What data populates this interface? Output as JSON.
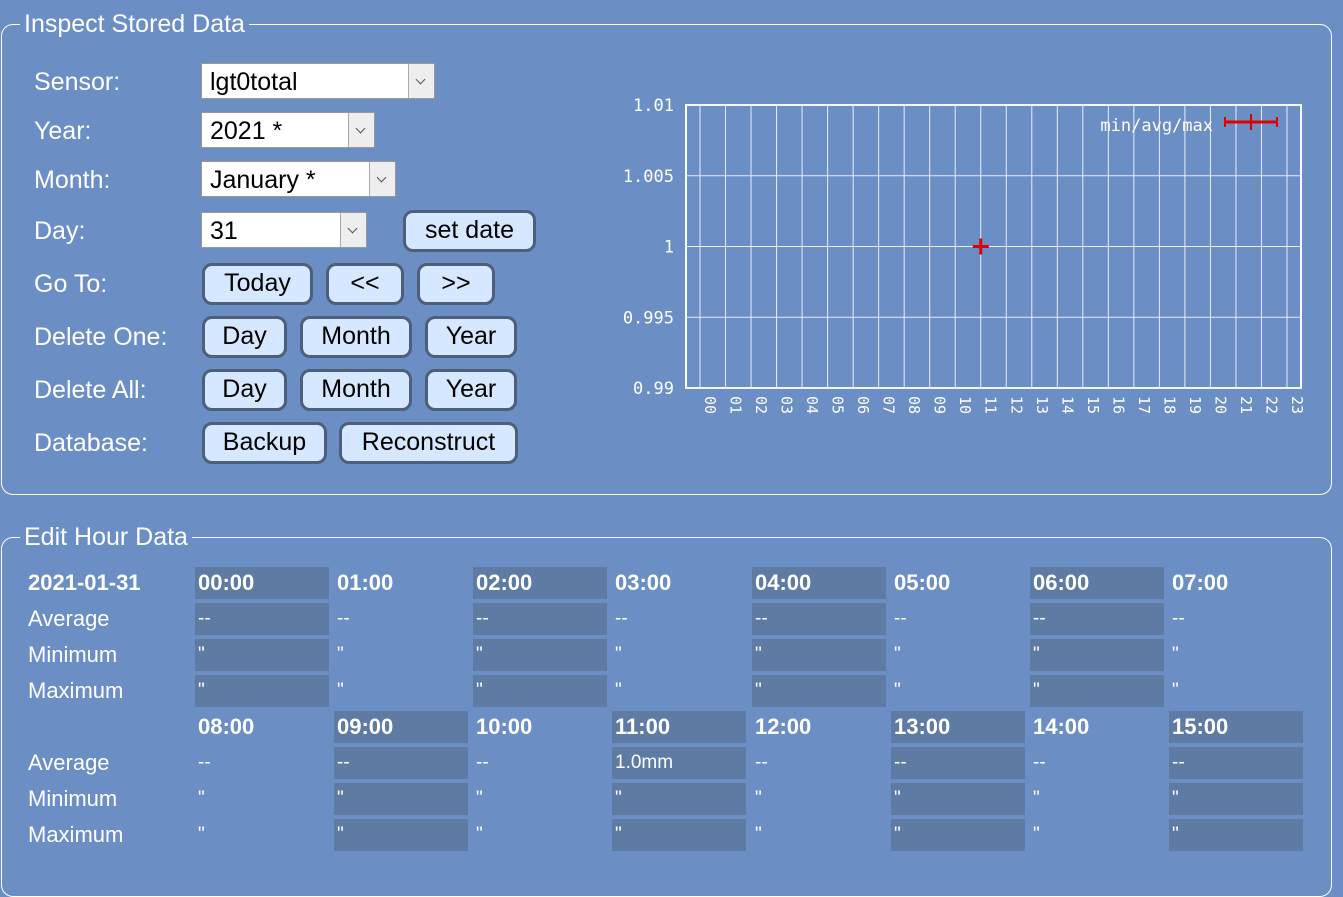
{
  "inspect": {
    "legend": "Inspect Stored Data",
    "labels": {
      "sensor": "Sensor:",
      "year": "Year:",
      "month": "Month:",
      "day": "Day:",
      "goto": "Go To:",
      "delete_one": "Delete One:",
      "delete_all": "Delete All:",
      "database": "Database:"
    },
    "selects": {
      "sensor": "lgt0total",
      "year": "2021 *",
      "month": "January *",
      "day": "31"
    },
    "buttons": {
      "set_date": "set date",
      "today": "Today",
      "prev": "<<",
      "next": ">>",
      "del_one_day": "Day",
      "del_one_month": "Month",
      "del_one_year": "Year",
      "del_all_day": "Day",
      "del_all_month": "Month",
      "del_all_year": "Year",
      "backup": "Backup",
      "reconstruct": "Reconstruct"
    }
  },
  "chart_data": {
    "type": "scatter",
    "legend": "min/avg/max",
    "legend_position": "top-right",
    "grid": true,
    "categories": [
      "00",
      "01",
      "02",
      "03",
      "04",
      "05",
      "06",
      "07",
      "08",
      "09",
      "10",
      "11",
      "12",
      "13",
      "14",
      "15",
      "16",
      "17",
      "18",
      "19",
      "20",
      "21",
      "22",
      "23"
    ],
    "yticks": [
      "1.01",
      "1.005",
      "1",
      "0.995",
      "0.99"
    ],
    "ylim": [
      0.99,
      1.01
    ],
    "points": [
      {
        "x": "11",
        "avg": 1.0,
        "min": 1.0,
        "max": 1.0
      }
    ],
    "color": "#e00000"
  },
  "hours": {
    "legend": "Edit Hour Data",
    "date": "2021-01-31",
    "row_labels": [
      "Average",
      "Minimum",
      "Maximum"
    ],
    "blocks": [
      {
        "cells": [
          {
            "hour": "00:00",
            "average": "--",
            "minimum": "\"",
            "maximum": "\""
          },
          {
            "hour": "01:00",
            "average": "--",
            "minimum": "\"",
            "maximum": "\""
          },
          {
            "hour": "02:00",
            "average": "--",
            "minimum": "\"",
            "maximum": "\""
          },
          {
            "hour": "03:00",
            "average": "--",
            "minimum": "\"",
            "maximum": "\""
          },
          {
            "hour": "04:00",
            "average": "--",
            "minimum": "\"",
            "maximum": "\""
          },
          {
            "hour": "05:00",
            "average": "--",
            "minimum": "\"",
            "maximum": "\""
          },
          {
            "hour": "06:00",
            "average": "--",
            "minimum": "\"",
            "maximum": "\""
          },
          {
            "hour": "07:00",
            "average": "--",
            "minimum": "\"",
            "maximum": "\""
          }
        ]
      },
      {
        "cells": [
          {
            "hour": "08:00",
            "average": "--",
            "minimum": "\"",
            "maximum": "\""
          },
          {
            "hour": "09:00",
            "average": "--",
            "minimum": "\"",
            "maximum": "\""
          },
          {
            "hour": "10:00",
            "average": "--",
            "minimum": "\"",
            "maximum": "\""
          },
          {
            "hour": "11:00",
            "average": "1.0mm",
            "minimum": "\"",
            "maximum": "\""
          },
          {
            "hour": "12:00",
            "average": "--",
            "minimum": "\"",
            "maximum": "\""
          },
          {
            "hour": "13:00",
            "average": "--",
            "minimum": "\"",
            "maximum": "\""
          },
          {
            "hour": "14:00",
            "average": "--",
            "minimum": "\"",
            "maximum": "\""
          },
          {
            "hour": "15:00",
            "average": "--",
            "minimum": "\"",
            "maximum": "\""
          }
        ]
      }
    ]
  }
}
